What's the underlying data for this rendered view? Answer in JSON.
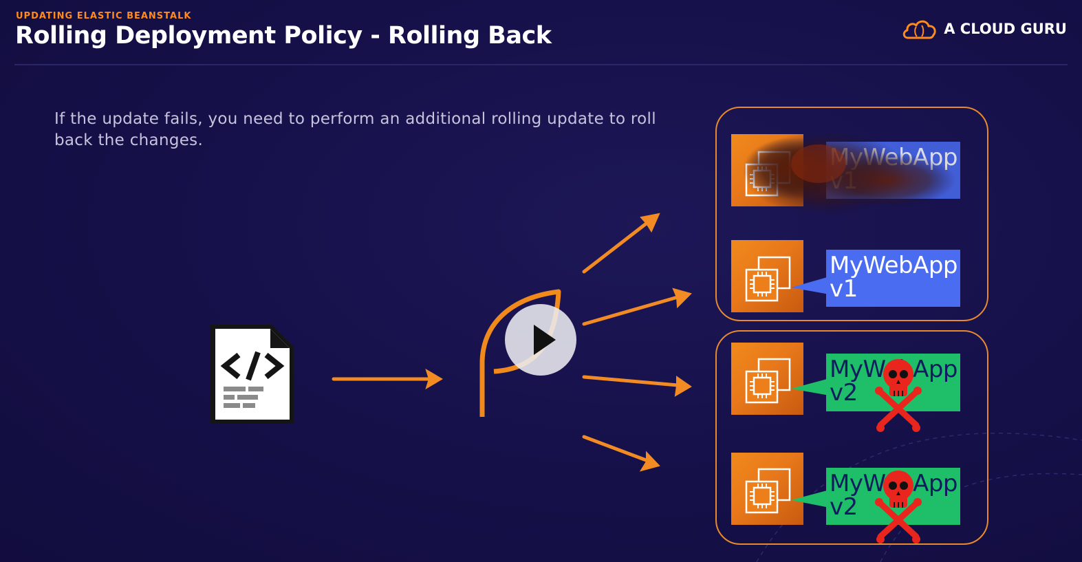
{
  "header": {
    "eyebrow": "UPDATING ELASTIC BEANSTALK",
    "title": "Rolling Deployment Policy - Rolling Back",
    "brand": "A CLOUD GURU"
  },
  "body": {
    "text": "If the update fails, you need to perform an additional rolling update to roll back the changes."
  },
  "instances": [
    {
      "app": "MyWebApp",
      "version": "v1",
      "status": "destroyed"
    },
    {
      "app": "MyWebApp",
      "version": "v1",
      "status": "healthy"
    },
    {
      "app": "MyWebApp",
      "version": "v2",
      "status": "failed"
    },
    {
      "app": "MyWebApp",
      "version": "v2",
      "status": "failed"
    }
  ],
  "icons": {
    "source": "code-document-icon",
    "deploy": "elastic-beanstalk-leaf-icon",
    "instance": "ec2-instance-icon",
    "failure": "skull-crossbones-icon",
    "player": "play-icon",
    "brand": "cloud-logo-icon"
  },
  "colors": {
    "accent": "#ff8a1e",
    "background": "#151048",
    "v1": "#4a6cf0",
    "v2": "#1fbf6a",
    "failure": "#e8261e"
  }
}
